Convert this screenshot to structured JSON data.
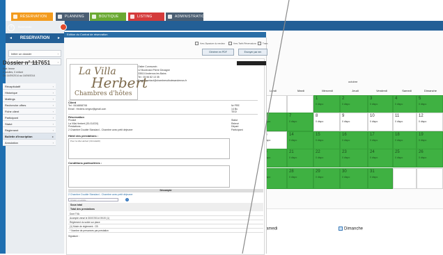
{
  "nav": {
    "tabs": [
      {
        "label": "RÉSERVATION",
        "color": "#f39b1d"
      },
      {
        "label": "PLANNING",
        "color": "#4b5e72"
      },
      {
        "label": "BOUTIQUE",
        "color": "#6aa932"
      },
      {
        "label": "LISTING",
        "color": "#d43b3b"
      },
      {
        "label": "ADMINISTRATION",
        "color": "#4b5e72"
      }
    ]
  },
  "sidebar": {
    "user_label": "Bonmondo",
    "section_title": "RESERVATION",
    "buttons": [
      "Initier un dossier",
      "Rechercher un dossier"
    ],
    "dossier_title": "Dossier n° 117651",
    "status": "Etat: ferme",
    "guests": "2 adultes, 0 enfant",
    "dates": "Du 14/09/2014 au 16/09/2014",
    "menu": [
      "Récapitulatif",
      "Historique",
      "Mailings",
      "Recherche offres",
      "Fiche client",
      "Participant",
      "Statut",
      "Règlement",
      "Bulletin d'inscription",
      "Annulation"
    ]
  },
  "modal": {
    "title": "Edition du Contrat de réservation",
    "options": [
      "Avec Signature du vendeur",
      "Avec Tarifs Réservations",
      "Trans"
    ],
    "buttons": [
      "Générer en PDF",
      "Envoyer par em"
    ],
    "right_bar": "CONTRAT DE",
    "logo_line1": "La Villa",
    "logo_line2": "Herbert",
    "logo_line3": "Chambres d'hôtes",
    "address": [
      "Ostier Conmunrin",
      "12 Boulevard Pierre Dezagne",
      "33510 Andernos les Bains",
      "Tel : 05 56 82 13 35",
      "Email : contact@chambresdhotesandernos.fr"
    ],
    "client_title": "Client",
    "client_lines": [
      "Tel : 0616858708",
      "Email : frederic.vergez@gmail.com"
    ],
    "client_right": [
      "Nr PRE",
      "14 Bu",
      "TEO!"
    ],
    "reservation_title": "Réservation",
    "reservation_lines": [
      "Produit",
      "La Villa Herbert (33-GLE20)",
      "Prestations :",
      "2 Chambre Double Standard - Chambre avec petit déjeuner"
    ],
    "reservation_right": [
      "Statut",
      "Relevé",
      "Départ",
      "Participant"
    ],
    "hotel_title": "Hôtel des prestations :",
    "hotel_value": "Pour la ville Herbert (33-GLE20)",
    "conditions_title": "Conditions particulières :",
    "decompte_title": "Décompte",
    "decompte_line": "2 Chambre Double Standard - Chambre avec petit déjeuner",
    "select_placeholder": "Choisir un article...",
    "sous_total": "Sous total",
    "total_prestations": "Total des prestations",
    "dont_title": "Dont TVA",
    "payment_lines": [
      "Acompte versé le 30/07/2014 09:20 (1)",
      "Règlement du solde sur place",
      "(1) Mode de règlement : CB",
      "* Nombre de personnes par prestation"
    ],
    "signature": "Signature :"
  },
  "calendar": {
    "month": "octobre",
    "weekdays": [
      "Dimanche",
      "Lundi",
      "Mardi",
      "Mercredi",
      "Jeudi",
      "Vendredi",
      "Samedi",
      "Dimanche"
    ],
    "days_label": "0 dispo",
    "rows": [
      [
        {
          "n": "",
          "s": "g"
        },
        {
          "n": "",
          "s": "w"
        },
        {
          "n": "",
          "s": "w"
        },
        {
          "n": "1",
          "s": "g"
        },
        {
          "n": "2",
          "s": "g"
        },
        {
          "n": "3",
          "s": "g"
        },
        {
          "n": "4",
          "s": "g"
        },
        {
          "n": "5",
          "s": "g"
        }
      ],
      [
        {
          "n": "",
          "s": "g"
        },
        {
          "n": "6",
          "s": "g"
        },
        {
          "n": "7",
          "s": "g"
        },
        {
          "n": "8",
          "s": "w"
        },
        {
          "n": "9",
          "s": "w"
        },
        {
          "n": "10",
          "s": "w"
        },
        {
          "n": "11",
          "s": "w"
        },
        {
          "n": "12",
          "s": "w"
        }
      ],
      [
        {
          "n": "",
          "s": "g"
        },
        {
          "n": "13",
          "s": "w"
        },
        {
          "n": "14",
          "s": "g"
        },
        {
          "n": "15",
          "s": "g"
        },
        {
          "n": "16",
          "s": "g"
        },
        {
          "n": "17",
          "s": "g"
        },
        {
          "n": "18",
          "s": "g"
        },
        {
          "n": "19",
          "s": "g"
        }
      ],
      [
        {
          "n": "",
          "s": "g"
        },
        {
          "n": "20",
          "s": "g"
        },
        {
          "n": "21",
          "s": "g"
        },
        {
          "n": "22",
          "s": "g"
        },
        {
          "n": "23",
          "s": "g"
        },
        {
          "n": "24",
          "s": "g"
        },
        {
          "n": "25",
          "s": "g"
        },
        {
          "n": "26",
          "s": "g"
        }
      ],
      [
        {
          "n": "",
          "s": "w"
        },
        {
          "n": "27",
          "s": "g"
        },
        {
          "n": "28",
          "s": "g"
        },
        {
          "n": "29",
          "s": "g"
        },
        {
          "n": "30",
          "s": "g"
        },
        {
          "n": "31",
          "s": "g"
        },
        {
          "n": "",
          "s": "w"
        },
        {
          "n": "",
          "s": "w"
        }
      ]
    ],
    "checkboxes": [
      "Samedi",
      "Dimanche"
    ]
  }
}
